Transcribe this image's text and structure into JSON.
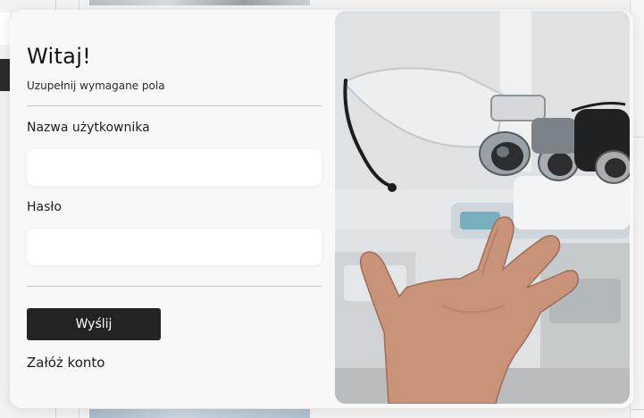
{
  "login": {
    "title": "Witaj!",
    "subtitle": "Uzupełnij wymagane pola",
    "username_label": "Nazwa użytkownika",
    "username_value": "",
    "password_label": "Hasło",
    "password_value": "",
    "submit_label": "Wyślij",
    "register_link": "Załóż konto"
  },
  "colors": {
    "button_bg": "#232323",
    "button_text": "#ffffff",
    "modal_bg": "#f8f8f8",
    "input_bg": "#ffffff"
  },
  "icons": {
    "photo": "dental-loupes-floating-over-open-hand"
  }
}
